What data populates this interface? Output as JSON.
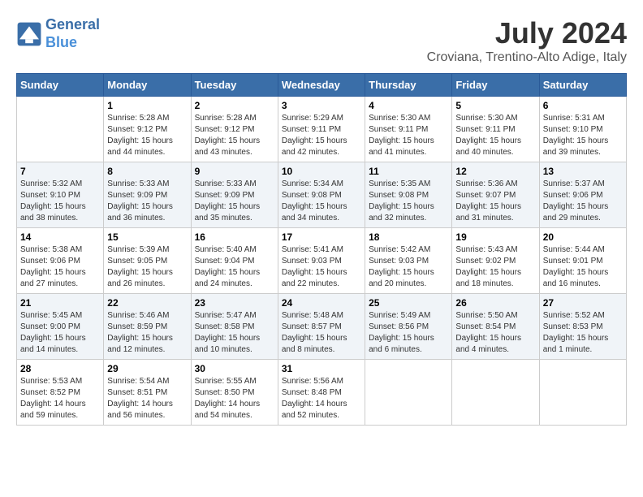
{
  "header": {
    "logo_line1": "General",
    "logo_line2": "Blue",
    "month_year": "July 2024",
    "location": "Croviana, Trentino-Alto Adige, Italy"
  },
  "weekdays": [
    "Sunday",
    "Monday",
    "Tuesday",
    "Wednesday",
    "Thursday",
    "Friday",
    "Saturday"
  ],
  "weeks": [
    [
      {
        "day": "",
        "info": ""
      },
      {
        "day": "1",
        "info": "Sunrise: 5:28 AM\nSunset: 9:12 PM\nDaylight: 15 hours\nand 44 minutes."
      },
      {
        "day": "2",
        "info": "Sunrise: 5:28 AM\nSunset: 9:12 PM\nDaylight: 15 hours\nand 43 minutes."
      },
      {
        "day": "3",
        "info": "Sunrise: 5:29 AM\nSunset: 9:11 PM\nDaylight: 15 hours\nand 42 minutes."
      },
      {
        "day": "4",
        "info": "Sunrise: 5:30 AM\nSunset: 9:11 PM\nDaylight: 15 hours\nand 41 minutes."
      },
      {
        "day": "5",
        "info": "Sunrise: 5:30 AM\nSunset: 9:11 PM\nDaylight: 15 hours\nand 40 minutes."
      },
      {
        "day": "6",
        "info": "Sunrise: 5:31 AM\nSunset: 9:10 PM\nDaylight: 15 hours\nand 39 minutes."
      }
    ],
    [
      {
        "day": "7",
        "info": "Sunrise: 5:32 AM\nSunset: 9:10 PM\nDaylight: 15 hours\nand 38 minutes."
      },
      {
        "day": "8",
        "info": "Sunrise: 5:33 AM\nSunset: 9:09 PM\nDaylight: 15 hours\nand 36 minutes."
      },
      {
        "day": "9",
        "info": "Sunrise: 5:33 AM\nSunset: 9:09 PM\nDaylight: 15 hours\nand 35 minutes."
      },
      {
        "day": "10",
        "info": "Sunrise: 5:34 AM\nSunset: 9:08 PM\nDaylight: 15 hours\nand 34 minutes."
      },
      {
        "day": "11",
        "info": "Sunrise: 5:35 AM\nSunset: 9:08 PM\nDaylight: 15 hours\nand 32 minutes."
      },
      {
        "day": "12",
        "info": "Sunrise: 5:36 AM\nSunset: 9:07 PM\nDaylight: 15 hours\nand 31 minutes."
      },
      {
        "day": "13",
        "info": "Sunrise: 5:37 AM\nSunset: 9:06 PM\nDaylight: 15 hours\nand 29 minutes."
      }
    ],
    [
      {
        "day": "14",
        "info": "Sunrise: 5:38 AM\nSunset: 9:06 PM\nDaylight: 15 hours\nand 27 minutes."
      },
      {
        "day": "15",
        "info": "Sunrise: 5:39 AM\nSunset: 9:05 PM\nDaylight: 15 hours\nand 26 minutes."
      },
      {
        "day": "16",
        "info": "Sunrise: 5:40 AM\nSunset: 9:04 PM\nDaylight: 15 hours\nand 24 minutes."
      },
      {
        "day": "17",
        "info": "Sunrise: 5:41 AM\nSunset: 9:03 PM\nDaylight: 15 hours\nand 22 minutes."
      },
      {
        "day": "18",
        "info": "Sunrise: 5:42 AM\nSunset: 9:03 PM\nDaylight: 15 hours\nand 20 minutes."
      },
      {
        "day": "19",
        "info": "Sunrise: 5:43 AM\nSunset: 9:02 PM\nDaylight: 15 hours\nand 18 minutes."
      },
      {
        "day": "20",
        "info": "Sunrise: 5:44 AM\nSunset: 9:01 PM\nDaylight: 15 hours\nand 16 minutes."
      }
    ],
    [
      {
        "day": "21",
        "info": "Sunrise: 5:45 AM\nSunset: 9:00 PM\nDaylight: 15 hours\nand 14 minutes."
      },
      {
        "day": "22",
        "info": "Sunrise: 5:46 AM\nSunset: 8:59 PM\nDaylight: 15 hours\nand 12 minutes."
      },
      {
        "day": "23",
        "info": "Sunrise: 5:47 AM\nSunset: 8:58 PM\nDaylight: 15 hours\nand 10 minutes."
      },
      {
        "day": "24",
        "info": "Sunrise: 5:48 AM\nSunset: 8:57 PM\nDaylight: 15 hours\nand 8 minutes."
      },
      {
        "day": "25",
        "info": "Sunrise: 5:49 AM\nSunset: 8:56 PM\nDaylight: 15 hours\nand 6 minutes."
      },
      {
        "day": "26",
        "info": "Sunrise: 5:50 AM\nSunset: 8:54 PM\nDaylight: 15 hours\nand 4 minutes."
      },
      {
        "day": "27",
        "info": "Sunrise: 5:52 AM\nSunset: 8:53 PM\nDaylight: 15 hours\nand 1 minute."
      }
    ],
    [
      {
        "day": "28",
        "info": "Sunrise: 5:53 AM\nSunset: 8:52 PM\nDaylight: 14 hours\nand 59 minutes."
      },
      {
        "day": "29",
        "info": "Sunrise: 5:54 AM\nSunset: 8:51 PM\nDaylight: 14 hours\nand 56 minutes."
      },
      {
        "day": "30",
        "info": "Sunrise: 5:55 AM\nSunset: 8:50 PM\nDaylight: 14 hours\nand 54 minutes."
      },
      {
        "day": "31",
        "info": "Sunrise: 5:56 AM\nSunset: 8:48 PM\nDaylight: 14 hours\nand 52 minutes."
      },
      {
        "day": "",
        "info": ""
      },
      {
        "day": "",
        "info": ""
      },
      {
        "day": "",
        "info": ""
      }
    ]
  ]
}
